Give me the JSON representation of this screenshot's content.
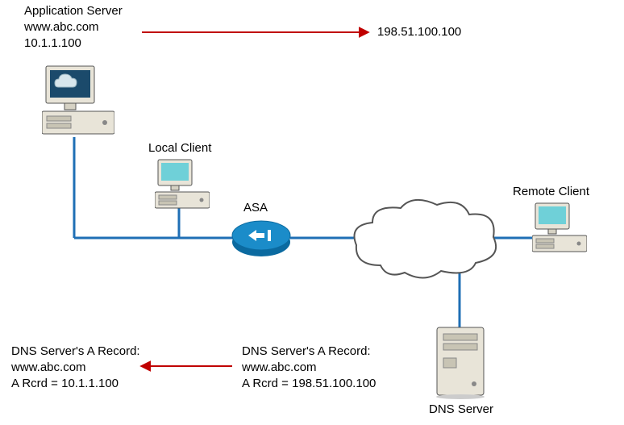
{
  "app_server": {
    "title": "Application Server",
    "hostname": "www.abc.com",
    "ip": "10.1.1.100"
  },
  "nat_ip": "198.51.100.100",
  "local_client": {
    "label": "Local Client"
  },
  "asa": {
    "label": "ASA"
  },
  "remote_client": {
    "label": "Remote Client"
  },
  "dns_server": {
    "label": "DNS Server"
  },
  "dns_internal": {
    "header": "DNS Server's A Record:",
    "host": "www.abc.com",
    "record": "A Rcrd = 10.1.1.100"
  },
  "dns_external": {
    "header": "DNS Server's A Record:",
    "host": "www.abc.com",
    "record": "A Rcrd = 198.51.100.100"
  }
}
